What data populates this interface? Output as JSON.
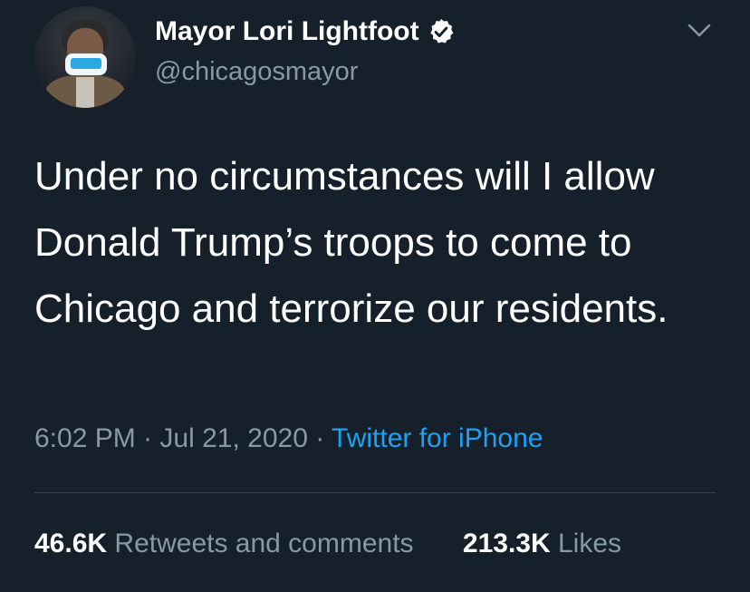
{
  "tweet": {
    "author": {
      "display_name": "Mayor Lori Lightfoot",
      "handle": "@chicagosmayor",
      "verified": true
    },
    "text": "Under no circumstances will I allow Donald Trump’s troops to come to Chicago and terrorize our residents.",
    "time": "6:02 PM",
    "separator": "·",
    "date": "Jul 21, 2020",
    "source": "Twitter for iPhone",
    "stats": {
      "retweets_count": "46.6K",
      "retweets_label": "Retweets and comments",
      "likes_count": "213.3K",
      "likes_label": "Likes"
    }
  },
  "colors": {
    "background": "#15202b",
    "primary_text": "#ffffff",
    "secondary_text": "#8899a6",
    "link": "#1da1f2",
    "divider": "#38444d"
  },
  "icons": {
    "verified": "verified-badge-icon",
    "menu": "chevron-down-icon"
  }
}
